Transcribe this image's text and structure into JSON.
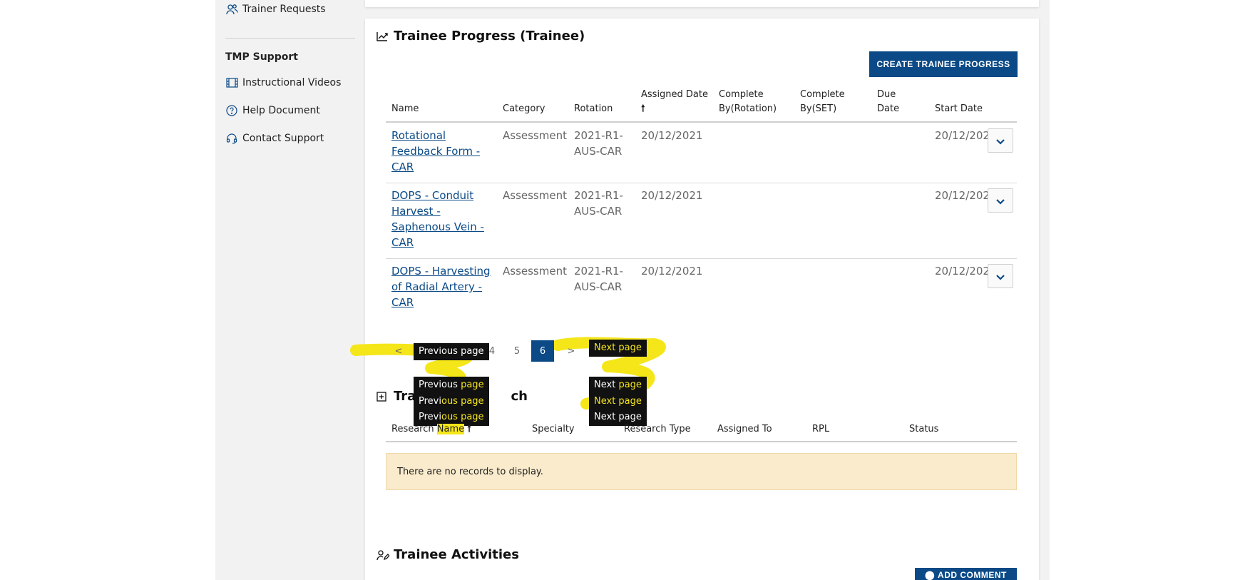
{
  "sidebar": {
    "items_top": [
      {
        "label": "Trainer Requests",
        "icon": "people-icon"
      }
    ],
    "support_heading": "TMP Support",
    "support_items": [
      {
        "label": "Instructional Videos",
        "icon": "film-icon"
      },
      {
        "label": "Help Document",
        "icon": "help-circle-icon"
      },
      {
        "label": "Contact Support",
        "icon": "headset-icon"
      }
    ]
  },
  "progress": {
    "title": "Trainee Progress (Trainee)",
    "create_label": "CREATE TRAINEE PROGRESS",
    "headers": {
      "name": "Name",
      "category": "Category",
      "rotation": "Rotation",
      "assigned_1": "Assigned Date",
      "assigned_sort": "🠕",
      "complete_rot_1": "Complete",
      "complete_rot_2": "By(Rotation)",
      "complete_set_1": "Complete",
      "complete_set_2": "By(SET)",
      "due_1": "Due",
      "due_2": "Date",
      "start": "Start Date"
    },
    "rows": [
      {
        "name_lines": [
          "Rotational",
          "Feedback Form -",
          "CAR"
        ],
        "category": "Assessment",
        "rotation_lines": [
          "2021-R1-",
          "AUS-CAR"
        ],
        "assigned": "20/12/2021",
        "start": "20/12/2021"
      },
      {
        "name_lines": [
          "DOPS - Conduit",
          "Harvest -",
          "Saphenous Vein -",
          "CAR"
        ],
        "category": "Assessment",
        "rotation_lines": [
          "2021-R1-",
          "AUS-CAR"
        ],
        "assigned": "20/12/2021",
        "start": "20/12/2021"
      },
      {
        "name_lines": [
          "DOPS - Harvesting",
          "of Radial Artery -",
          "CAR"
        ],
        "category": "Assessment",
        "rotation_lines": [
          "2021-R1-",
          "AUS-CAR"
        ],
        "assigned": "20/12/2021",
        "start": "20/12/2021"
      }
    ],
    "pagination": {
      "prev": "<",
      "pages": [
        "4",
        "5",
        "6"
      ],
      "current": "6",
      "next": ">"
    }
  },
  "tooltips": {
    "prev_plain": "Previous",
    "prev_hl": "page",
    "prev_full": "Previous page",
    "next_plain": "Next",
    "next_hl": "page",
    "next_full": "Next page",
    "prev_hl_2": "ous page",
    "prev_plain_2": "Previ",
    "next_hl_2": "Next page"
  },
  "research": {
    "title_start": "Trai",
    "title_end": "ch",
    "headers": {
      "name_plain": "Research ",
      "name_hl": "Name",
      "name_sort": "🠕",
      "specialty": "Specialty",
      "type": "Research Type",
      "assigned_to": "Assigned To",
      "rpl": "RPL",
      "status": "Status"
    },
    "empty": "There are no records to display."
  },
  "activities": {
    "title": "Trainee Activities",
    "add_label": "ADD COMMENT"
  },
  "colors": {
    "accent": "#0b4a86",
    "highlight": "#f5e61a",
    "empty_bg": "#faebcc"
  }
}
